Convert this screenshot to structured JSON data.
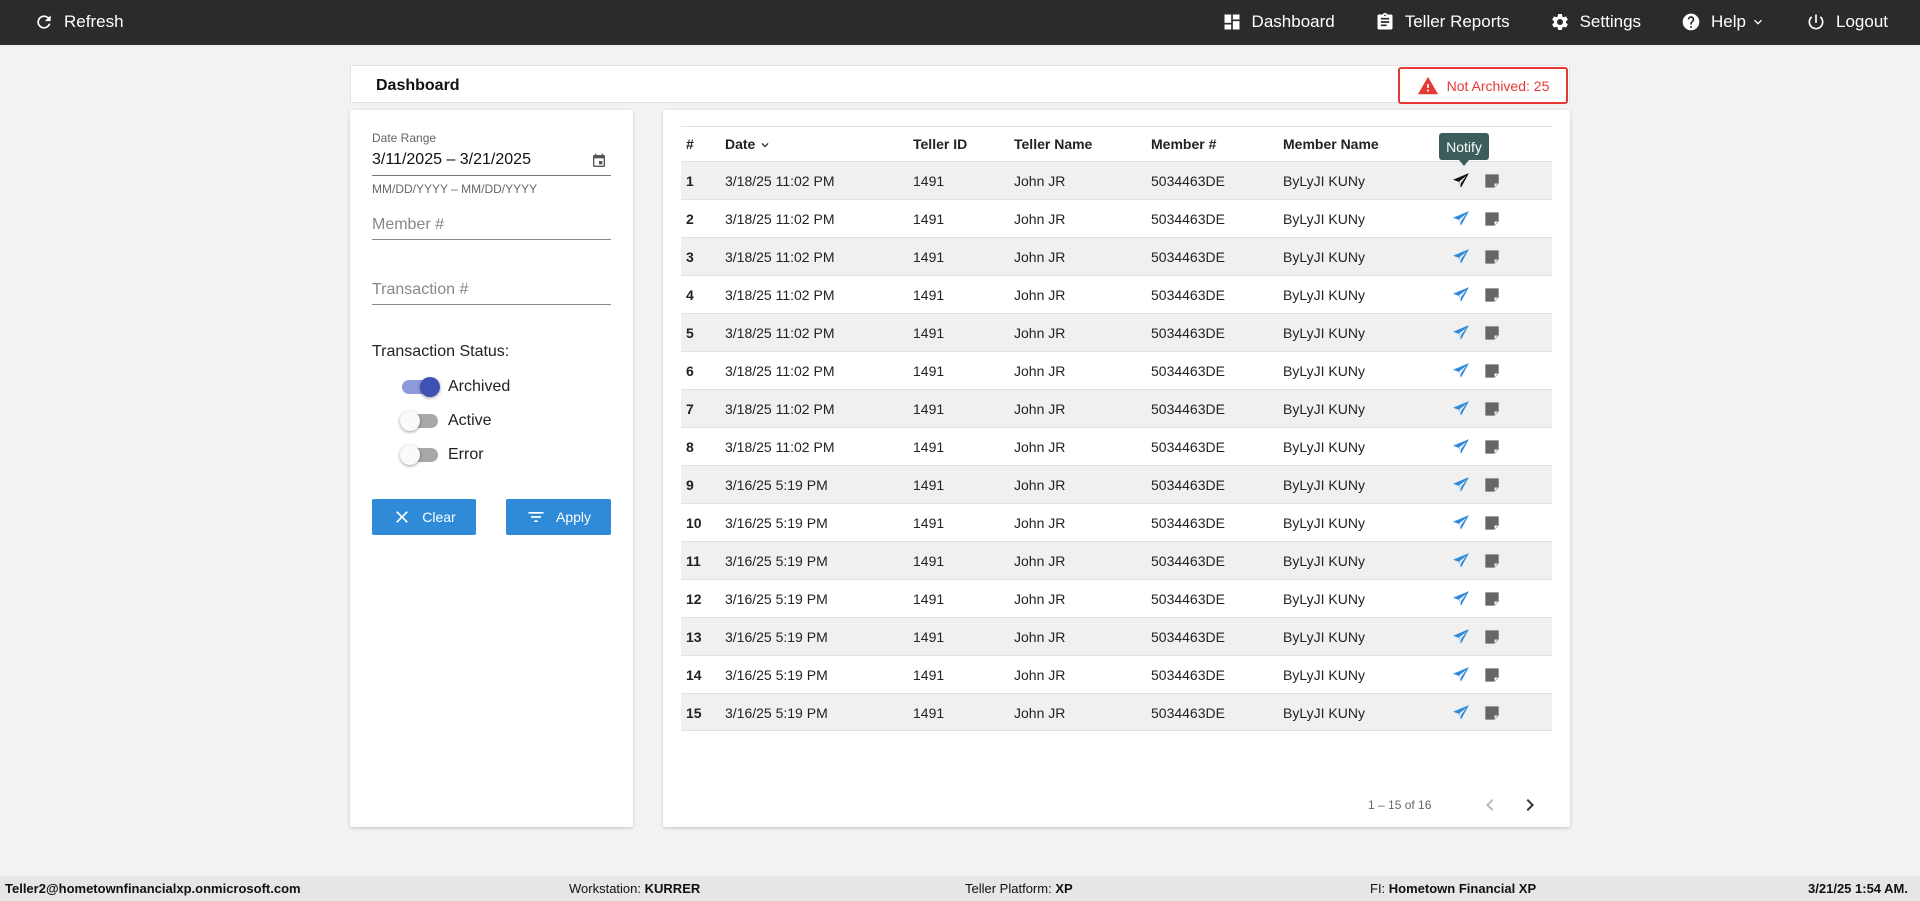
{
  "topbar": {
    "refresh_label": "Refresh",
    "nav": [
      {
        "label": "Dashboard",
        "icon": "dashboard-icon"
      },
      {
        "label": "Teller Reports",
        "icon": "clipboard-icon"
      },
      {
        "label": "Settings",
        "icon": "gear-icon"
      },
      {
        "label": "Help",
        "icon": "help-icon"
      },
      {
        "label": "Logout",
        "icon": "power-icon"
      }
    ]
  },
  "header": {
    "title": "Dashboard",
    "badge": "Not Archived: 25",
    "badge_color": "#e53935"
  },
  "filters": {
    "date_range_label": "Date Range",
    "date_range_value": "3/11/2025 – 3/21/2025",
    "date_hint": "MM/DD/YYYY – MM/DD/YYYY",
    "member_placeholder": "Member #",
    "transaction_placeholder": "Transaction #",
    "status_label": "Transaction Status:",
    "statuses": [
      {
        "label": "Archived",
        "on": true
      },
      {
        "label": "Active",
        "on": false
      },
      {
        "label": "Error",
        "on": false
      }
    ],
    "clear_label": "Clear",
    "apply_label": "Apply",
    "accent": "#2f8ad8"
  },
  "table": {
    "columns": [
      "#",
      "Date",
      "Teller ID",
      "Teller Name",
      "Member #",
      "Member Name"
    ],
    "rows": [
      {
        "n": "1",
        "date": "3/18/25 11:02 PM",
        "teller_id": "1491",
        "teller_name": "John JR",
        "member": "5034463DE",
        "member_name": "ByLyJI KUNy"
      },
      {
        "n": "2",
        "date": "3/18/25 11:02 PM",
        "teller_id": "1491",
        "teller_name": "John JR",
        "member": "5034463DE",
        "member_name": "ByLyJI KUNy"
      },
      {
        "n": "3",
        "date": "3/18/25 11:02 PM",
        "teller_id": "1491",
        "teller_name": "John JR",
        "member": "5034463DE",
        "member_name": "ByLyJI KUNy"
      },
      {
        "n": "4",
        "date": "3/18/25 11:02 PM",
        "teller_id": "1491",
        "teller_name": "John JR",
        "member": "5034463DE",
        "member_name": "ByLyJI KUNy"
      },
      {
        "n": "5",
        "date": "3/18/25 11:02 PM",
        "teller_id": "1491",
        "teller_name": "John JR",
        "member": "5034463DE",
        "member_name": "ByLyJI KUNy"
      },
      {
        "n": "6",
        "date": "3/18/25 11:02 PM",
        "teller_id": "1491",
        "teller_name": "John JR",
        "member": "5034463DE",
        "member_name": "ByLyJI KUNy"
      },
      {
        "n": "7",
        "date": "3/18/25 11:02 PM",
        "teller_id": "1491",
        "teller_name": "John JR",
        "member": "5034463DE",
        "member_name": "ByLyJI KUNy"
      },
      {
        "n": "8",
        "date": "3/18/25 11:02 PM",
        "teller_id": "1491",
        "teller_name": "John JR",
        "member": "5034463DE",
        "member_name": "ByLyJI KUNy"
      },
      {
        "n": "9",
        "date": "3/16/25 5:19 PM",
        "teller_id": "1491",
        "teller_name": "John JR",
        "member": "5034463DE",
        "member_name": "ByLyJI KUNy"
      },
      {
        "n": "10",
        "date": "3/16/25 5:19 PM",
        "teller_id": "1491",
        "teller_name": "John JR",
        "member": "5034463DE",
        "member_name": "ByLyJI KUNy"
      },
      {
        "n": "11",
        "date": "3/16/25 5:19 PM",
        "teller_id": "1491",
        "teller_name": "John JR",
        "member": "5034463DE",
        "member_name": "ByLyJI KUNy"
      },
      {
        "n": "12",
        "date": "3/16/25 5:19 PM",
        "teller_id": "1491",
        "teller_name": "John JR",
        "member": "5034463DE",
        "member_name": "ByLyJI KUNy"
      },
      {
        "n": "13",
        "date": "3/16/25 5:19 PM",
        "teller_id": "1491",
        "teller_name": "John JR",
        "member": "5034463DE",
        "member_name": "ByLyJI KUNy"
      },
      {
        "n": "14",
        "date": "3/16/25 5:19 PM",
        "teller_id": "1491",
        "teller_name": "John JR",
        "member": "5034463DE",
        "member_name": "ByLyJI KUNy"
      },
      {
        "n": "15",
        "date": "3/16/25 5:19 PM",
        "teller_id": "1491",
        "teller_name": "John JR",
        "member": "5034463DE",
        "member_name": "ByLyJI KUNy"
      }
    ],
    "tooltip": "Notify",
    "hovered_row": 0,
    "pagination": "1 – 15 of 16",
    "notify_color": "#2f8ad8",
    "note_color": "#666666"
  },
  "footer": {
    "user": "Teller2@hometownfinancialxp.onmicrosoft.com",
    "workstation_label": "Workstation:",
    "workstation": "KURRER",
    "platform_label": "Teller Platform:",
    "platform": "XP",
    "fi_label": "FI:",
    "fi": "Hometown Financial XP",
    "datetime": "3/21/25 1:54 AM."
  }
}
